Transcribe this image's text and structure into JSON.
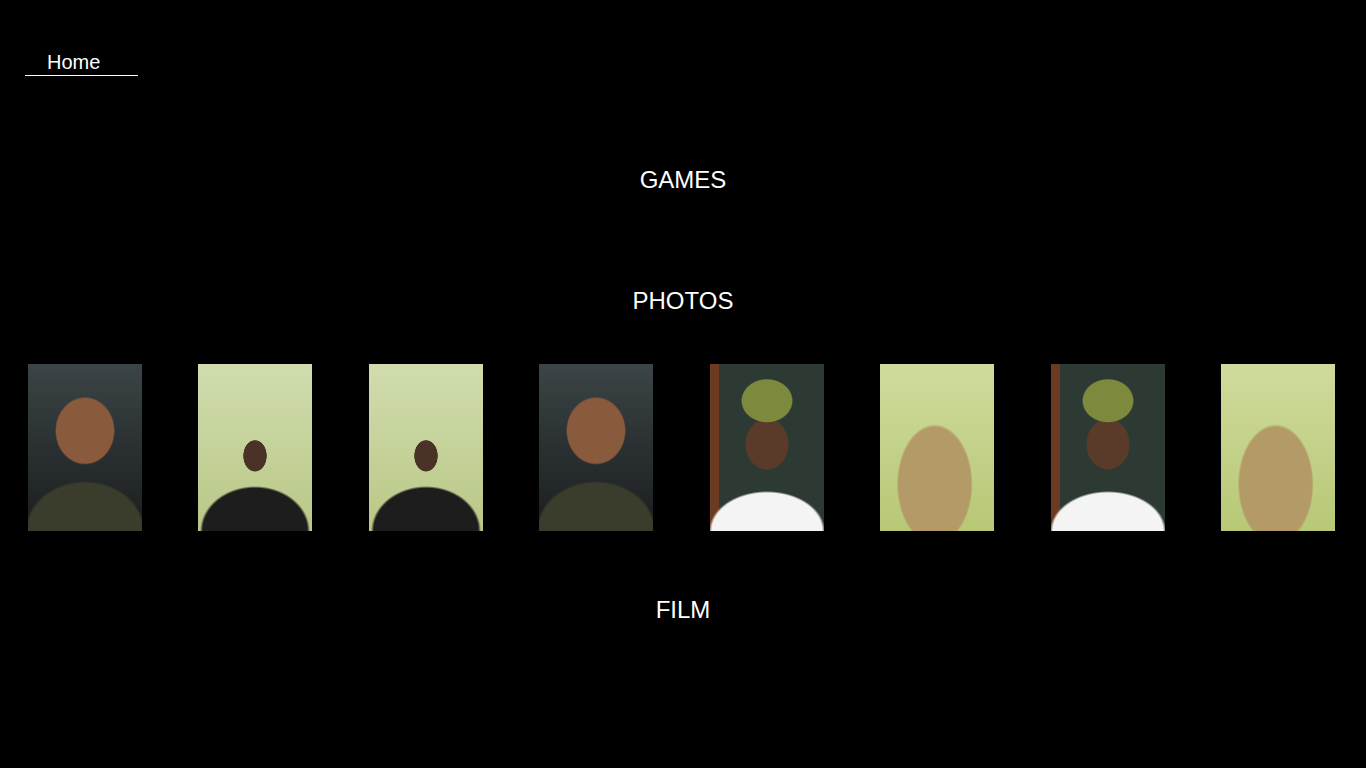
{
  "nav": {
    "home": "Home"
  },
  "sections": [
    {
      "title": "GAMES"
    },
    {
      "title": "PHOTOS"
    },
    {
      "title": "FILM"
    }
  ],
  "photos": [
    {
      "kind": "photo"
    },
    {
      "kind": "photo"
    },
    {
      "kind": "photo"
    },
    {
      "kind": "photo"
    },
    {
      "kind": "photo"
    },
    {
      "kind": "photo"
    },
    {
      "kind": "photo"
    },
    {
      "kind": "photo"
    }
  ]
}
